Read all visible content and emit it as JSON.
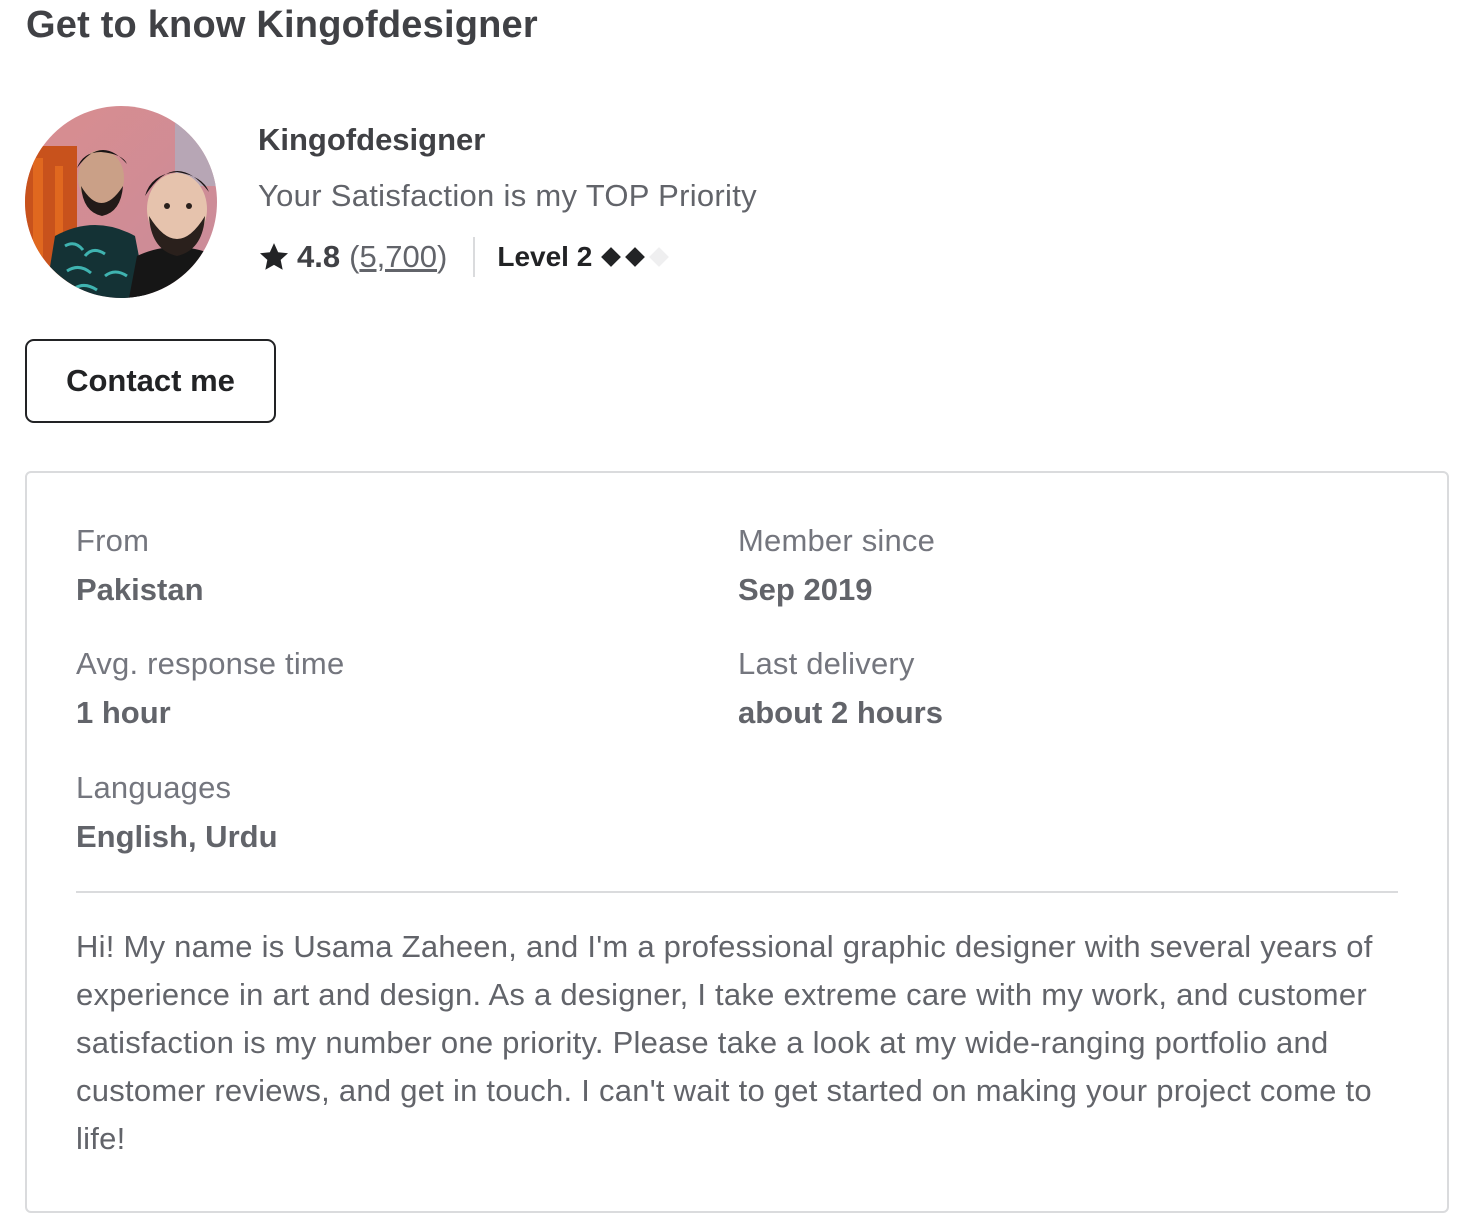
{
  "section": {
    "title": "Get to know Kingofdesigner"
  },
  "seller": {
    "name": "Kingofdesigner",
    "tagline": "Your Satisfaction is my TOP Priority",
    "rating": "4.8",
    "reviews_open": "(",
    "reviews_count": "5,700",
    "reviews_close": ")",
    "level_label": "Level 2",
    "level_diamonds_filled": 2,
    "level_diamonds_total": 3,
    "avatar_icon": "seller-avatar-photo"
  },
  "actions": {
    "contact_label": "Contact me"
  },
  "details": {
    "from_label": "From",
    "from_value": "Pakistan",
    "member_since_label": "Member since",
    "member_since_value": "Sep 2019",
    "response_label": "Avg. response time",
    "response_value": "1 hour",
    "last_delivery_label": "Last delivery",
    "last_delivery_value": "about 2 hours",
    "languages_label": "Languages",
    "languages_value": "English, Urdu"
  },
  "bio": {
    "text": "Hi! My name is Usama Zaheen, and I'm a professional graphic designer with several years of experience in art and design. As a designer, I take extreme care with my work, and customer satisfaction is my number one priority. Please take a look at my wide-ranging portfolio and customer reviews, and get in touch. I can't wait to get started on making your project come to life!"
  },
  "colors": {
    "text_dark": "#222325",
    "text_primary": "#404145",
    "text_secondary": "#62646a",
    "text_muted": "#74767e",
    "border": "#dadbdd",
    "diamond_empty": "#efeff0"
  }
}
